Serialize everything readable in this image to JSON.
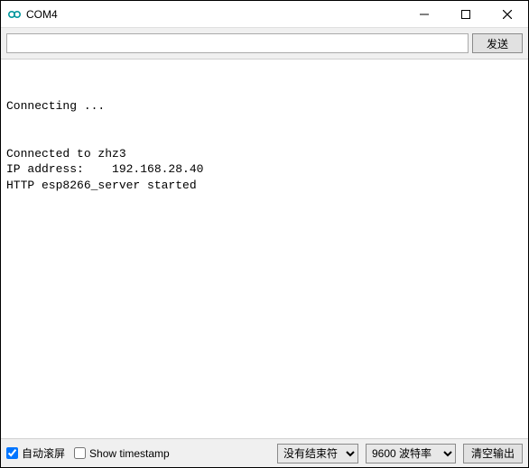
{
  "window": {
    "title": "COM4"
  },
  "toolbar": {
    "send_label": "发送",
    "input_value": ""
  },
  "console": {
    "text": "\n\nConnecting ...\n\n\nConnected to zhz3\nIP address:    192.168.28.40\nHTTP esp8266_server started"
  },
  "statusbar": {
    "autoscroll_label": "自动滚屏",
    "autoscroll_checked": true,
    "timestamp_label": "Show timestamp",
    "timestamp_checked": false,
    "line_ending_selected": "没有结束符",
    "baud_selected": "9600 波特率",
    "clear_label": "清空输出"
  }
}
